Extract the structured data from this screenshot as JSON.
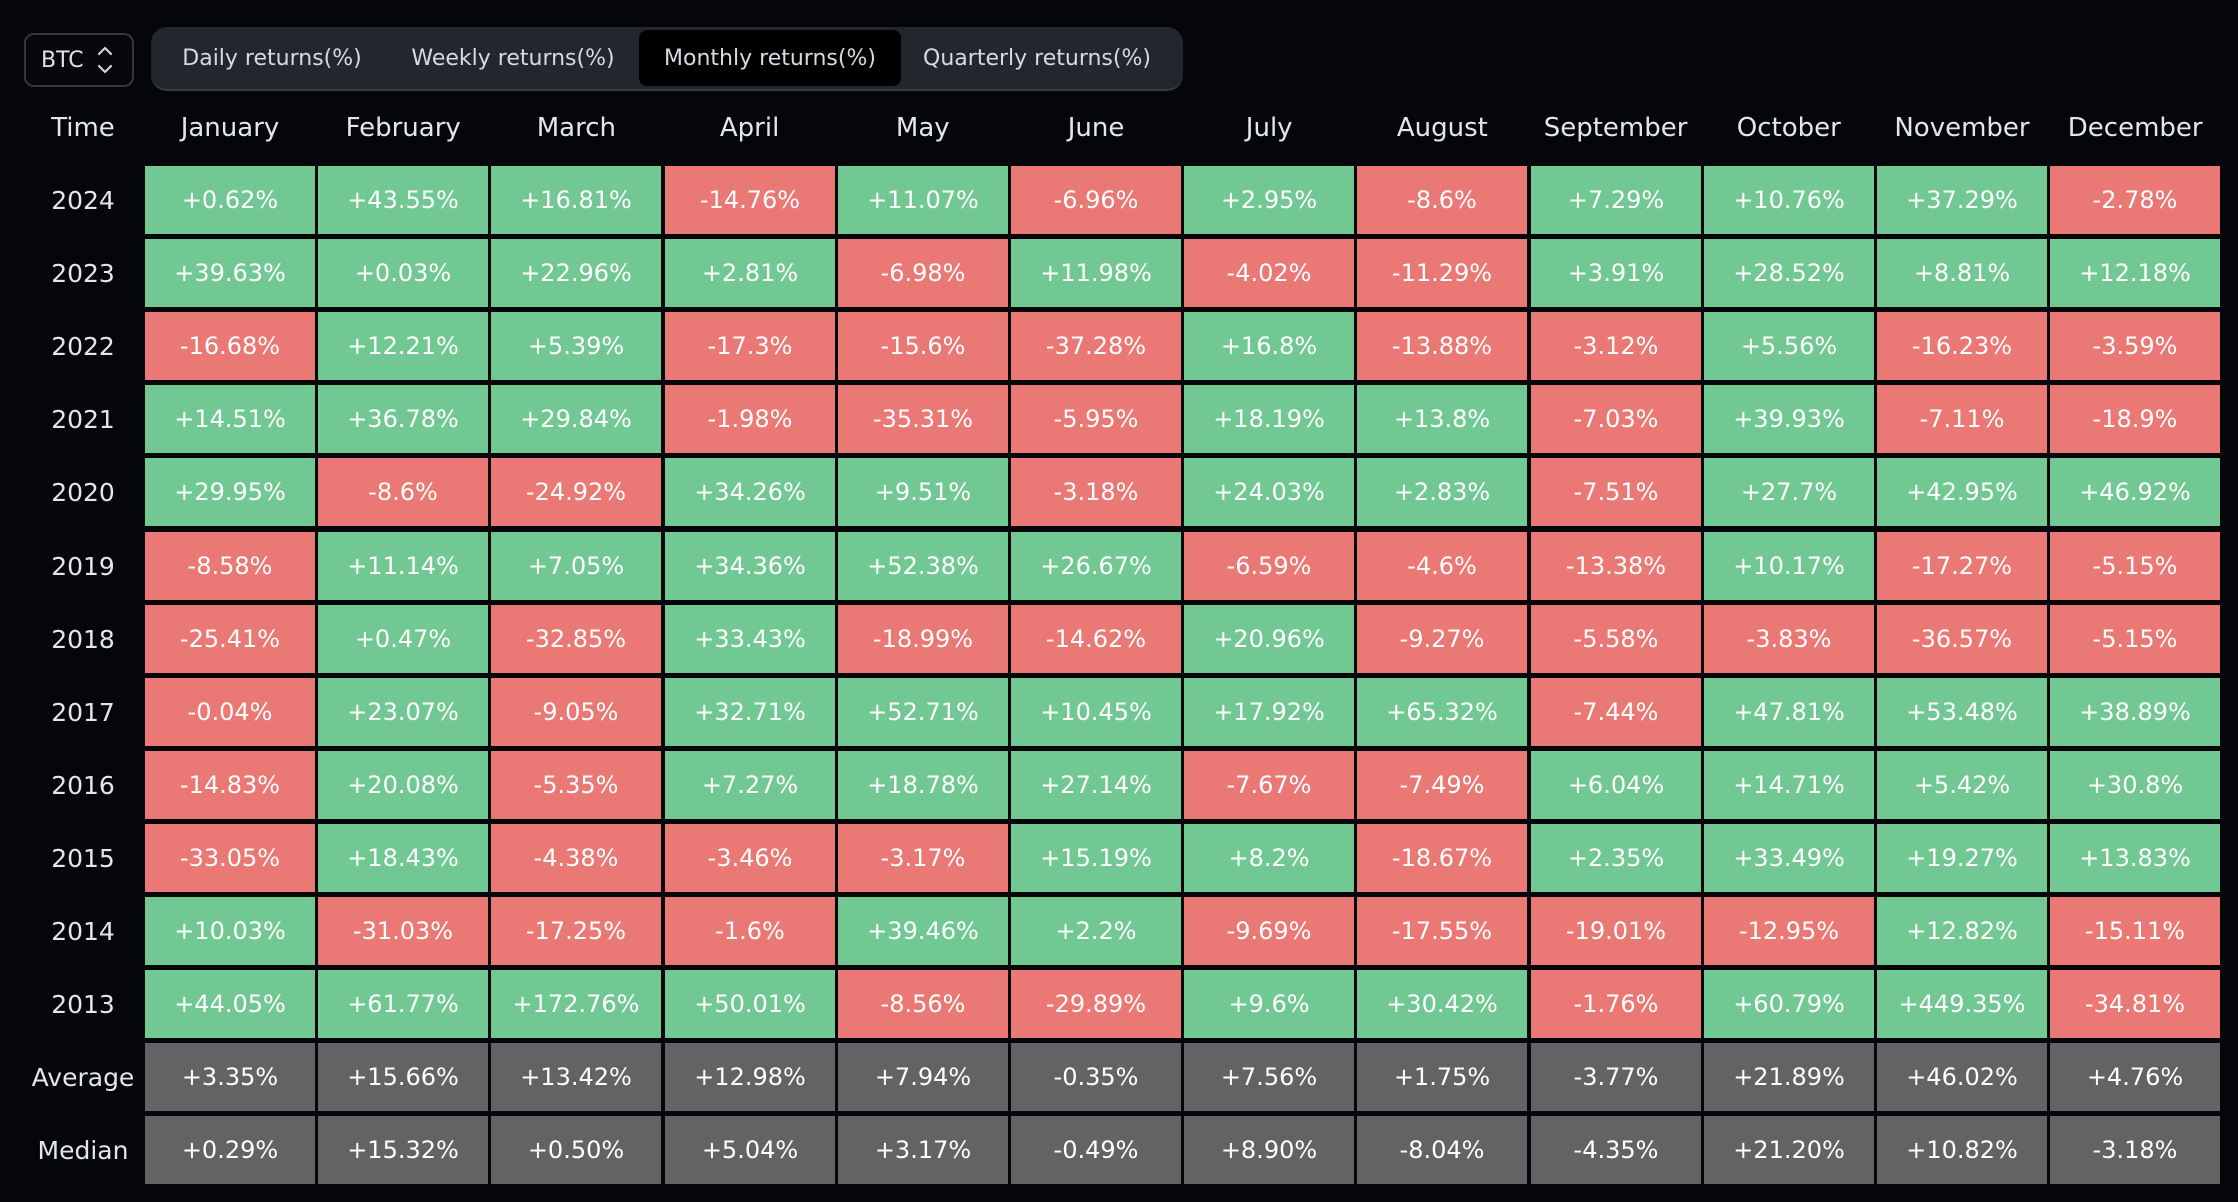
{
  "asset_selector": {
    "value": "BTC",
    "icon": "chevron-up-down-icon"
  },
  "tabs": [
    {
      "label": "Daily returns(%)",
      "active": false
    },
    {
      "label": "Weekly returns(%)",
      "active": false
    },
    {
      "label": "Monthly returns(%)",
      "active": true
    },
    {
      "label": "Quarterly returns(%)",
      "active": false
    }
  ],
  "colors": {
    "positive": "#72c893",
    "negative": "#ea7874",
    "summary": "#636365",
    "background": "#05060a"
  },
  "table": {
    "time_header": "Time",
    "months": [
      "January",
      "February",
      "March",
      "April",
      "May",
      "June",
      "July",
      "August",
      "September",
      "October",
      "November",
      "December"
    ],
    "rows": [
      {
        "label": "2024",
        "values": [
          "+0.62%",
          "+43.55%",
          "+16.81%",
          "-14.76%",
          "+11.07%",
          "-6.96%",
          "+2.95%",
          "-8.6%",
          "+7.29%",
          "+10.76%",
          "+37.29%",
          "-2.78%"
        ]
      },
      {
        "label": "2023",
        "values": [
          "+39.63%",
          "+0.03%",
          "+22.96%",
          "+2.81%",
          "-6.98%",
          "+11.98%",
          "-4.02%",
          "-11.29%",
          "+3.91%",
          "+28.52%",
          "+8.81%",
          "+12.18%"
        ]
      },
      {
        "label": "2022",
        "values": [
          "-16.68%",
          "+12.21%",
          "+5.39%",
          "-17.3%",
          "-15.6%",
          "-37.28%",
          "+16.8%",
          "-13.88%",
          "-3.12%",
          "+5.56%",
          "-16.23%",
          "-3.59%"
        ]
      },
      {
        "label": "2021",
        "values": [
          "+14.51%",
          "+36.78%",
          "+29.84%",
          "-1.98%",
          "-35.31%",
          "-5.95%",
          "+18.19%",
          "+13.8%",
          "-7.03%",
          "+39.93%",
          "-7.11%",
          "-18.9%"
        ]
      },
      {
        "label": "2020",
        "values": [
          "+29.95%",
          "-8.6%",
          "-24.92%",
          "+34.26%",
          "+9.51%",
          "-3.18%",
          "+24.03%",
          "+2.83%",
          "-7.51%",
          "+27.7%",
          "+42.95%",
          "+46.92%"
        ]
      },
      {
        "label": "2019",
        "values": [
          "-8.58%",
          "+11.14%",
          "+7.05%",
          "+34.36%",
          "+52.38%",
          "+26.67%",
          "-6.59%",
          "-4.6%",
          "-13.38%",
          "+10.17%",
          "-17.27%",
          "-5.15%"
        ]
      },
      {
        "label": "2018",
        "values": [
          "-25.41%",
          "+0.47%",
          "-32.85%",
          "+33.43%",
          "-18.99%",
          "-14.62%",
          "+20.96%",
          "-9.27%",
          "-5.58%",
          "-3.83%",
          "-36.57%",
          "-5.15%"
        ]
      },
      {
        "label": "2017",
        "values": [
          "-0.04%",
          "+23.07%",
          "-9.05%",
          "+32.71%",
          "+52.71%",
          "+10.45%",
          "+17.92%",
          "+65.32%",
          "-7.44%",
          "+47.81%",
          "+53.48%",
          "+38.89%"
        ]
      },
      {
        "label": "2016",
        "values": [
          "-14.83%",
          "+20.08%",
          "-5.35%",
          "+7.27%",
          "+18.78%",
          "+27.14%",
          "-7.67%",
          "-7.49%",
          "+6.04%",
          "+14.71%",
          "+5.42%",
          "+30.8%"
        ]
      },
      {
        "label": "2015",
        "values": [
          "-33.05%",
          "+18.43%",
          "-4.38%",
          "-3.46%",
          "-3.17%",
          "+15.19%",
          "+8.2%",
          "-18.67%",
          "+2.35%",
          "+33.49%",
          "+19.27%",
          "+13.83%"
        ]
      },
      {
        "label": "2014",
        "values": [
          "+10.03%",
          "-31.03%",
          "-17.25%",
          "-1.6%",
          "+39.46%",
          "+2.2%",
          "-9.69%",
          "-17.55%",
          "-19.01%",
          "-12.95%",
          "+12.82%",
          "-15.11%"
        ]
      },
      {
        "label": "2013",
        "values": [
          "+44.05%",
          "+61.77%",
          "+172.76%",
          "+50.01%",
          "-8.56%",
          "-29.89%",
          "+9.6%",
          "+30.42%",
          "-1.76%",
          "+60.79%",
          "+449.35%",
          "-34.81%"
        ]
      }
    ],
    "summary_rows": [
      {
        "label": "Average",
        "values": [
          "+3.35%",
          "+15.66%",
          "+13.42%",
          "+12.98%",
          "+7.94%",
          "-0.35%",
          "+7.56%",
          "+1.75%",
          "-3.77%",
          "+21.89%",
          "+46.02%",
          "+4.76%"
        ]
      },
      {
        "label": "Median",
        "values": [
          "+0.29%",
          "+15.32%",
          "+0.50%",
          "+5.04%",
          "+3.17%",
          "-0.49%",
          "+8.90%",
          "-8.04%",
          "-4.35%",
          "+21.20%",
          "+10.82%",
          "-3.18%"
        ]
      }
    ]
  }
}
